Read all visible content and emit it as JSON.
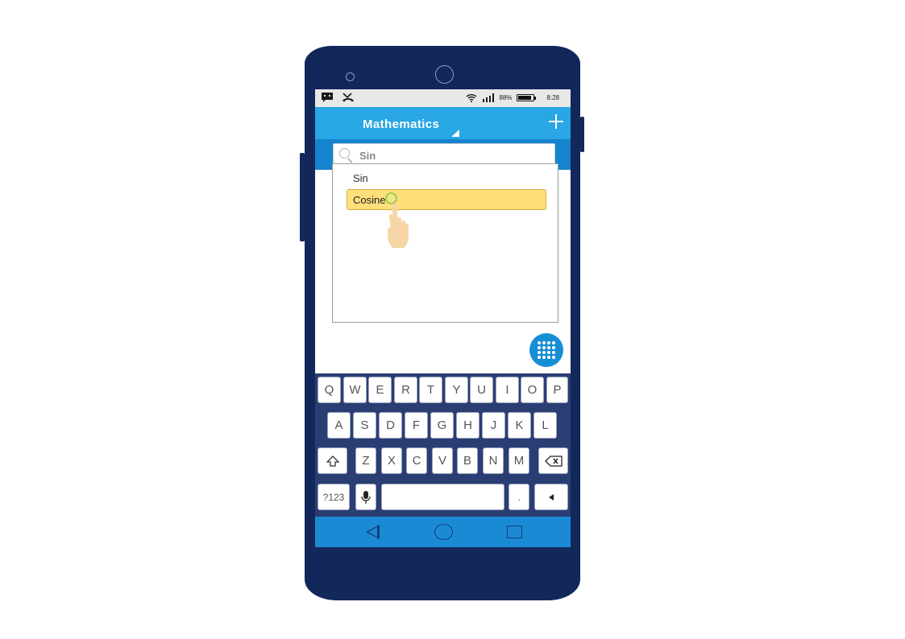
{
  "app": {
    "title": "Mathematics",
    "accent_color": "#29a6e4",
    "add_icon": "plus-icon"
  },
  "status_bar": {
    "battery": "88%",
    "time": "8:28",
    "icons": [
      "message-icon",
      "missed-call-icon",
      "wifi-icon",
      "signal-icon",
      "battery-icon"
    ]
  },
  "search": {
    "value": "Sin",
    "icon": "search-icon"
  },
  "dropdown": {
    "options": [
      {
        "label": "Sin",
        "highlighted": false
      },
      {
        "label": "Cosine",
        "highlighted": true
      }
    ],
    "highlight_color": "#ffdf7a"
  },
  "fab": {
    "icon": "grid-dots-icon"
  },
  "keyboard": {
    "row1": [
      "Q",
      "W",
      "E",
      "R",
      "T",
      "Y",
      "U",
      "I",
      "O",
      "P"
    ],
    "row2": [
      "A",
      "S",
      "D",
      "F",
      "G",
      "H",
      "J",
      "K",
      "L"
    ],
    "row3": [
      "Z",
      "X",
      "C",
      "V",
      "B",
      "N",
      "M"
    ],
    "shift_icon": "shift-icon",
    "backspace_icon": "backspace-icon",
    "symbols_label": "?123",
    "mic_icon": "microphone-icon",
    "period_label": ".",
    "enter_icon": "enter-icon"
  },
  "nav": [
    "back-icon",
    "home-icon",
    "recent-apps-icon"
  ]
}
